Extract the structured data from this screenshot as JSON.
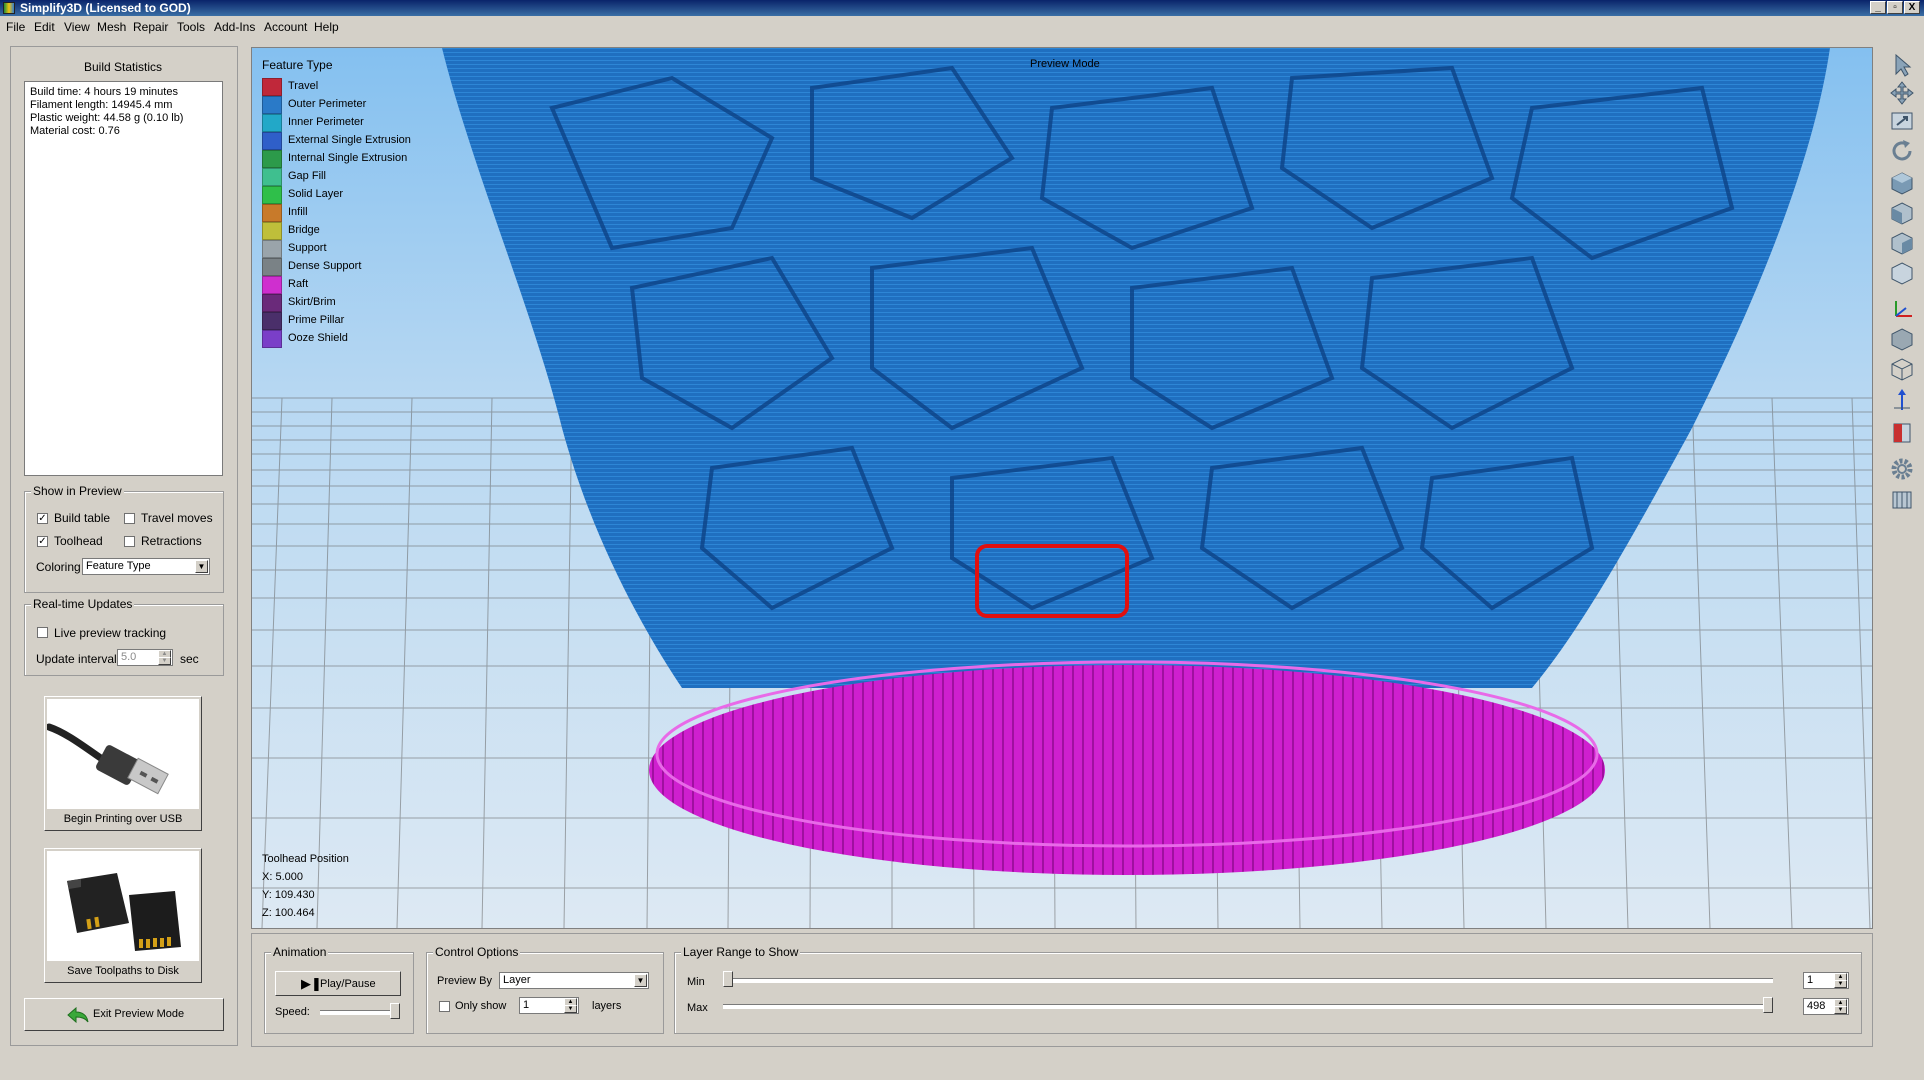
{
  "window": {
    "title": "Simplify3D (Licensed to GOD)",
    "controls": [
      "_",
      "▫",
      "X"
    ]
  },
  "menu": [
    "File",
    "Edit",
    "View",
    "Mesh",
    "Repair",
    "Tools",
    "Add-Ins",
    "Account",
    "Help"
  ],
  "build_statistics": {
    "title": "Build Statistics",
    "lines": [
      "Build time: 4 hours 19 minutes",
      "Filament length: 14945.4 mm",
      "Plastic weight: 44.58 g (0.10 lb)",
      "Material cost: 0.76"
    ]
  },
  "show_in_preview": {
    "title": "Show in Preview",
    "build_table": {
      "label": "Build table",
      "checked": true
    },
    "travel_moves": {
      "label": "Travel moves",
      "checked": false
    },
    "toolhead": {
      "label": "Toolhead",
      "checked": true
    },
    "retractions": {
      "label": "Retractions",
      "checked": false
    },
    "coloring_label": "Coloring",
    "coloring_value": "Feature Type"
  },
  "realtime_updates": {
    "title": "Real-time Updates",
    "live_preview_label": "Live preview tracking",
    "live_preview_checked": false,
    "interval_label": "Update interval",
    "interval_value": "5.0",
    "interval_unit": "sec"
  },
  "usb_button": {
    "label": "Begin Printing over USB",
    "icon": "usb-cable-image"
  },
  "disk_button": {
    "label": "Save Toolpaths to Disk",
    "icon": "sd-card-image"
  },
  "exit_preview": {
    "label": "Exit Preview Mode",
    "icon": "back-arrow-icon"
  },
  "viewport": {
    "preview_mode": "Preview Mode",
    "legend_title": "Feature Type",
    "legend": [
      {
        "label": "Travel",
        "color": "#c0283a"
      },
      {
        "label": "Outer Perimeter",
        "color": "#2a7ac8"
      },
      {
        "label": "Inner Perimeter",
        "color": "#22a8c8"
      },
      {
        "label": "External Single Extrusion",
        "color": "#2f5fc9"
      },
      {
        "label": "Internal Single Extrusion",
        "color": "#2c9a4a"
      },
      {
        "label": "Gap Fill",
        "color": "#3fbf8f"
      },
      {
        "label": "Solid Layer",
        "color": "#2fbf4a"
      },
      {
        "label": "Infill",
        "color": "#c87a2a"
      },
      {
        "label": "Bridge",
        "color": "#bfbf3a"
      },
      {
        "label": "Support",
        "color": "#9aa4aa"
      },
      {
        "label": "Dense Support",
        "color": "#7a8286"
      },
      {
        "label": "Raft",
        "color": "#cf2fcf"
      },
      {
        "label": "Skirt/Brim",
        "color": "#6a2a7a"
      },
      {
        "label": "Prime Pillar",
        "color": "#4a2f6a"
      },
      {
        "label": "Ooze Shield",
        "color": "#7a3fc8"
      }
    ],
    "toolhead_position": {
      "title": "Toolhead Position",
      "x": "X: 5.000",
      "y": "Y: 109.430",
      "z": "Z: 100.464"
    }
  },
  "right_toolbar": [
    "select-icon",
    "move-icon",
    "scale-icon",
    "rotate-icon",
    "view-top-icon",
    "view-front-icon",
    "view-right-icon",
    "view-iso-icon",
    "axes-icon",
    "solid-view-icon",
    "wireframe-icon",
    "normals-icon",
    "cross-section-icon",
    "settings-gear-icon",
    "build-volume-icon"
  ],
  "animation": {
    "title": "Animation",
    "play_pause_label": "Play/Pause",
    "speed_label": "Speed:",
    "speed_level": 1.0
  },
  "control_options": {
    "title": "Control Options",
    "preview_by_label": "Preview By",
    "preview_by_value": "Layer",
    "only_show_label": "Only show",
    "only_show_checked": false,
    "only_show_value": "1",
    "layers_label": "layers"
  },
  "layer_range": {
    "title": "Layer Range to Show",
    "min_label": "Min",
    "max_label": "Max",
    "min_value": "1",
    "max_value": "498",
    "min_layer": 1,
    "max_layer": 498,
    "total_layers": 498
  },
  "colors": {
    "print_blue": "#1f6fc0",
    "raft_magenta": "#d018d0",
    "highlight_red": "#e01010"
  }
}
